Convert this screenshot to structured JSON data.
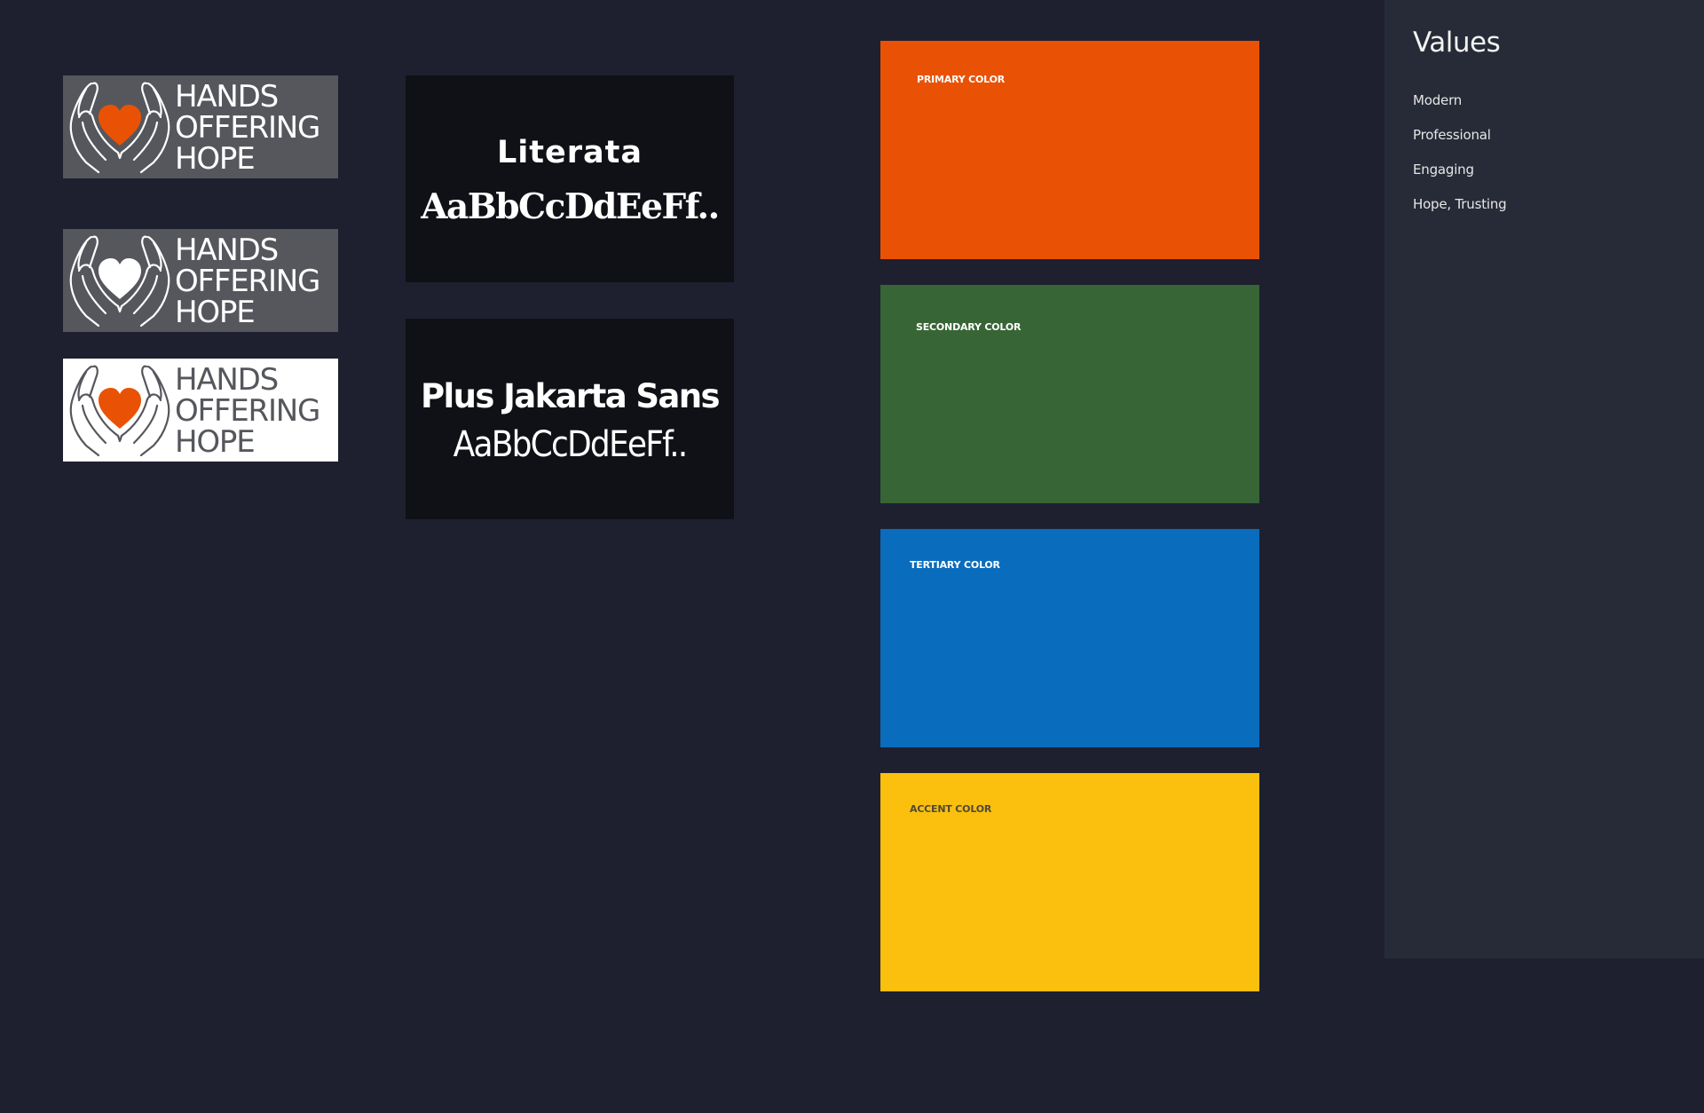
{
  "logos": [
    {
      "variant": "dark-orange-heart",
      "lines": [
        "HANDS",
        "OFFERING",
        "HOPE"
      ],
      "background": "#55575C",
      "text_color": "#FFFFFF",
      "heart_color": "#E95205",
      "hands_color": "#FFFFFF"
    },
    {
      "variant": "dark-white-heart",
      "lines": [
        "HANDS",
        "OFFERING",
        "HOPE"
      ],
      "background": "#55575C",
      "text_color": "#FFFFFF",
      "heart_color": "#FFFFFF",
      "hands_color": "#FFFFFF"
    },
    {
      "variant": "light-orange-heart",
      "lines": [
        "HANDS",
        "OFFERING",
        "HOPE"
      ],
      "background": "#FFFFFF",
      "text_color": "#55575C",
      "heart_color": "#E95205",
      "hands_color": "#55575C"
    }
  ],
  "typography": [
    {
      "font_name": "Literata",
      "sample": "AaBbCcDdEeFf.."
    },
    {
      "font_name": "Plus Jakarta Sans",
      "sample": "AaBbCcDdEeFf.."
    }
  ],
  "colors": [
    {
      "label": "PRIMARY COLOR",
      "hex": "#E95205"
    },
    {
      "label": "SECONDARY COLOR",
      "hex": "#386535"
    },
    {
      "label": "TERTIARY COLOR",
      "hex": "#0A6CBD"
    },
    {
      "label": "ACCENT COLOR",
      "hex": "#FBBF0D"
    }
  ],
  "values": {
    "title": "Values",
    "items": [
      "Modern",
      "Professional",
      "Engaging",
      "Hope, Trusting"
    ]
  }
}
